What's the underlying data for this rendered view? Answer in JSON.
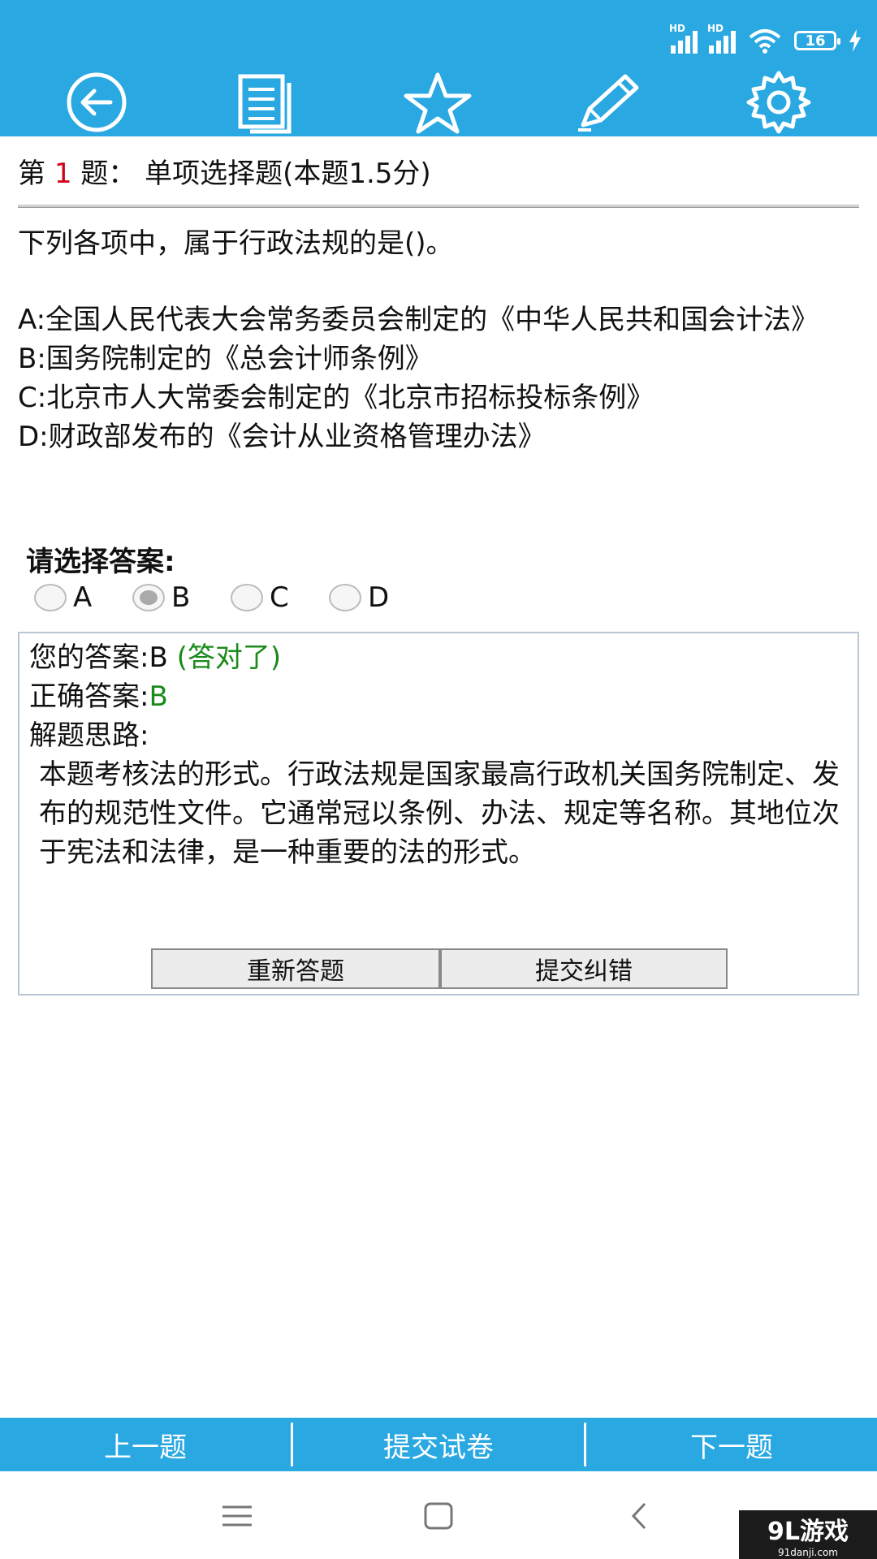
{
  "status": {
    "battery": "16",
    "hd1": "HD",
    "hd2": "HD"
  },
  "toolbar": {
    "icons": [
      "back-icon",
      "document-icon",
      "star-icon",
      "pencil-icon",
      "gear-icon"
    ]
  },
  "question_header": {
    "prefix": "第",
    "number": "1",
    "suffix": "题：  单项选择题(本题1.5分)"
  },
  "question": {
    "text": "下列各项中，属于行政法规的是()。",
    "options": [
      "A:全国人民代表大会常务委员会制定的《中华人民共和国会计法》",
      "B:国务院制定的《总会计师条例》",
      "C:北京市人大常委会制定的《北京市招标投标条例》",
      "D:财政部发布的《会计从业资格管理办法》"
    ]
  },
  "answer_select": {
    "label": "请选择答案:",
    "choices": [
      "A",
      "B",
      "C",
      "D"
    ],
    "selected": "B"
  },
  "result": {
    "your_answer_label": "您的答案:B",
    "your_answer_status": "(答对了)",
    "correct_label": "正确答案:",
    "correct_value": "B",
    "explain_label": "解题思路:",
    "explain_text": "本题考核法的形式。行政法规是国家最高行政机关国务院制定、发布的规范性文件。它通常冠以条例、办法、规定等名称。其地位次于宪法和法律，是一种重要的法的形式。",
    "retry_button": "重新答题",
    "report_button": "提交纠错"
  },
  "bottom_nav": {
    "prev": "上一题",
    "submit": "提交试卷",
    "next": "下一题"
  },
  "watermark": {
    "brand": "9L游戏",
    "site": "91danji.com"
  },
  "colors": {
    "accent": "#2aa8e2",
    "correct": "#1a8a1a",
    "number": "#d0021b"
  }
}
